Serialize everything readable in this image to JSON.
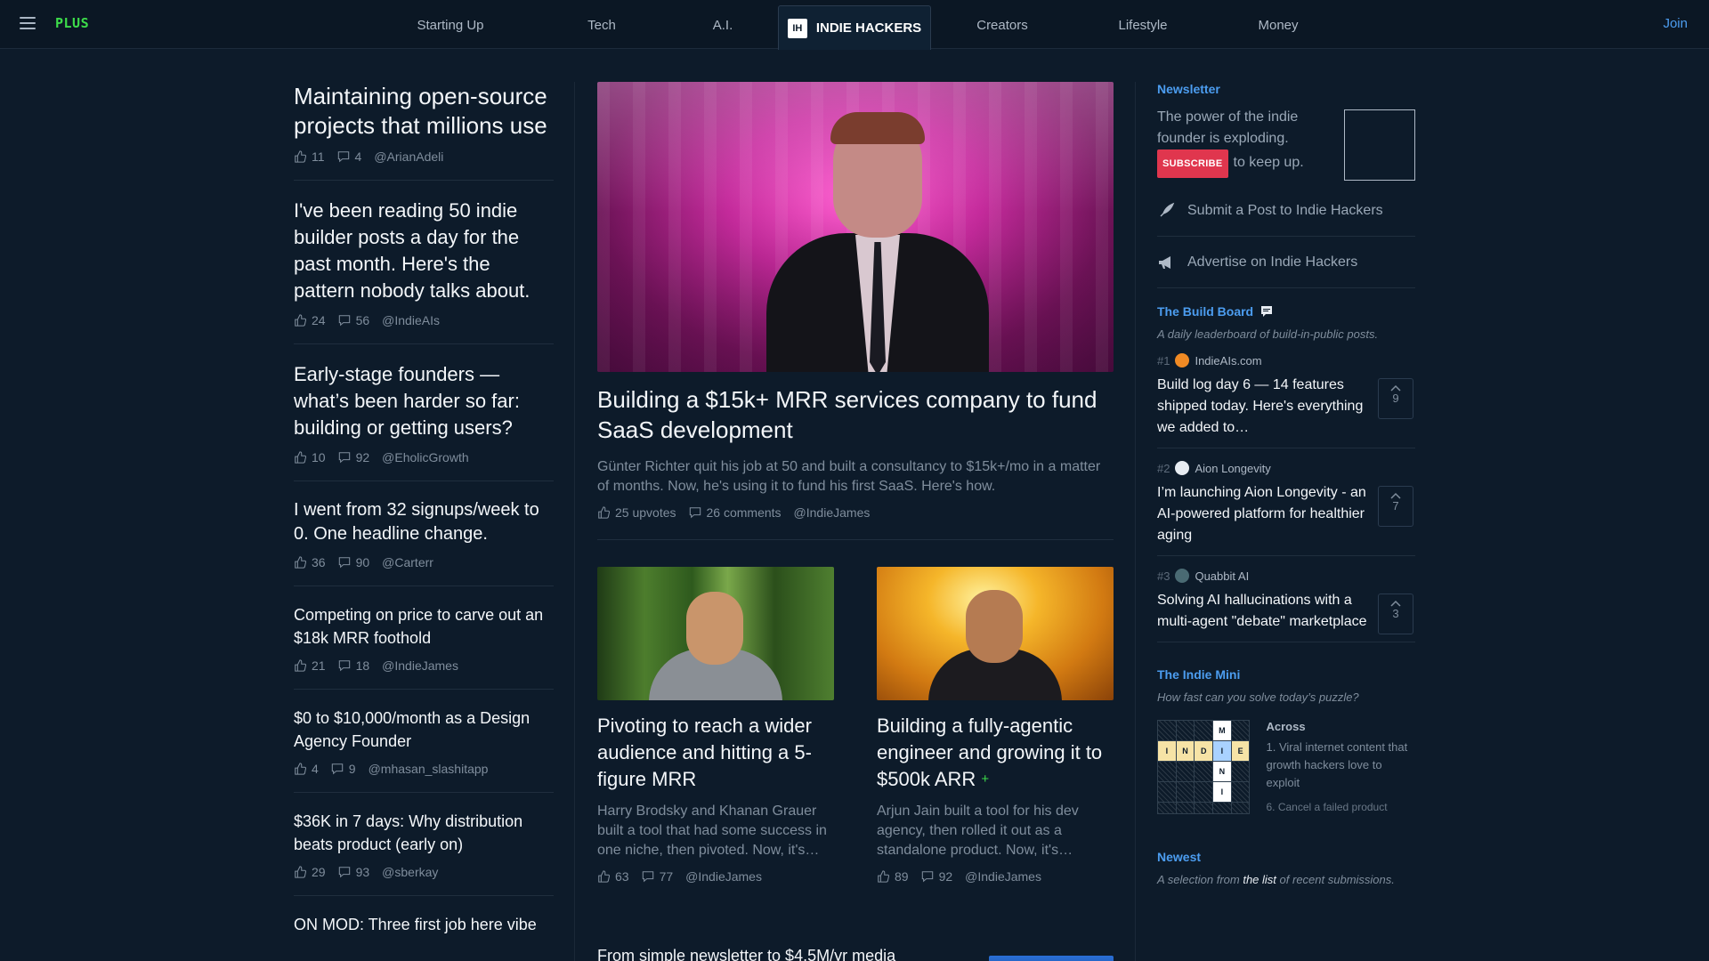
{
  "nav": {
    "logo": "PLUS",
    "tabs": [
      {
        "label": "Starting Up"
      },
      {
        "label": "Tech"
      },
      {
        "label": "A.I."
      },
      {
        "label": "INDIE HACKERS",
        "badge": "IH"
      },
      {
        "label": "Creators"
      },
      {
        "label": "Lifestyle"
      },
      {
        "label": "Money"
      }
    ],
    "join": "Join"
  },
  "left_posts": [
    {
      "title": "Maintaining open-source projects that millions use",
      "likes": "11",
      "comments": "4",
      "author": "@ArianAdeli"
    },
    {
      "title": "I've been reading 50 indie builder posts a day for the past month. Here's the pattern nobody talks about.",
      "likes": "24",
      "comments": "56",
      "author": "@IndieAIs"
    },
    {
      "title": "Early-stage founders — what’s been harder so far: building or getting users?",
      "likes": "10",
      "comments": "92",
      "author": "@EholicGrowth"
    },
    {
      "title": "I went from 32 signups/week to 0. One headline change.",
      "likes": "36",
      "comments": "90",
      "author": "@Carterr"
    },
    {
      "title": "Competing on price to carve out an $18k MRR foothold",
      "likes": "21",
      "comments": "18",
      "author": "@IndieJames"
    },
    {
      "title": "$0 to $10,000/month as a Design Agency Founder",
      "likes": "4",
      "comments": "9",
      "author": "@mhasan_slashitapp"
    },
    {
      "title": "$36K in 7 days: Why distribution beats product (early on)",
      "likes": "29",
      "comments": "93",
      "author": "@sberkay"
    },
    {
      "title": "ON MOD: Three first job here vibe"
    }
  ],
  "hero": {
    "title": "Building a $15k+ MRR services company to fund SaaS development",
    "desc": "Günter Richter quit his job at 50 and built a consultancy to $15k+/mo in a matter of months. Now, he's using it to fund his first SaaS. Here's how.",
    "upvotes": "25 upvotes",
    "comments": "26 comments",
    "author": "@IndieJames"
  },
  "cards": [
    {
      "title": "Pivoting to reach a wider audience and hitting a 5-figure MRR",
      "desc": "Harry Brodsky and Khanan Grauer built a tool that had some success in one niche, then pivoted. Now, it's…",
      "likes": "63",
      "comments": "77",
      "author": "@IndieJames"
    },
    {
      "title": "Building a fully-agentic engineer and growing it to $500k ARR",
      "plus": "+",
      "desc": "Arjun Jain built a tool for his dev agency, then rolled it out as a standalone product. Now, it's…",
      "likes": "89",
      "comments": "92",
      "author": "@IndieJames"
    }
  ],
  "more": {
    "title": "From simple newsletter to $4.5M/yr media"
  },
  "newsletter": {
    "label": "Newsletter",
    "text": "The power of the indie founder is exploding.",
    "subscribe": "SUBSCRIBE",
    "tail": "to keep up."
  },
  "actions": [
    {
      "label": "Submit a Post to Indie Hackers",
      "icon": "rocket-icon"
    },
    {
      "label": "Advertise on Indie Hackers",
      "icon": "megaphone-icon"
    }
  ],
  "build_board": {
    "label": "The Build Board",
    "sub": "A daily leaderboard of build-in-public posts.",
    "items": [
      {
        "rank": "#1",
        "name": "IndieAIs.com",
        "logo_color": "#f08a24",
        "title": "Build log day 6 — 14 features shipped today. Here's everything we added to…",
        "votes": "9"
      },
      {
        "rank": "#2",
        "name": "Aion Longevity",
        "logo_color": "#e7ecf2",
        "title": "I’m launching Aion Longevity - an AI-powered platform for healthier aging",
        "votes": "7"
      },
      {
        "rank": "#3",
        "name": "Quabbit AI",
        "logo_color": "#4a6a73",
        "title": "Solving AI hallucinations with a multi-agent \"debate\" marketplace",
        "votes": "3"
      }
    ]
  },
  "mini": {
    "label": "The Indie Mini",
    "sub": "How fast can you solve today’s puzzle?",
    "across": "Across",
    "clue1": "1. Viral internet content that growth hackers love to exploit",
    "clue2": "6. Cancel a failed product",
    "grid_letters": [
      "",
      "",
      "",
      "M",
      "",
      "I",
      "N",
      "D",
      "I",
      "E",
      "",
      "",
      "",
      "N",
      "",
      "",
      "",
      "",
      "I",
      "",
      "",
      "",
      "",
      "",
      ""
    ]
  },
  "newest": {
    "label": "Newest",
    "sub_pre": "A selection from ",
    "sub_link": "the list",
    "sub_post": " of recent submissions."
  }
}
